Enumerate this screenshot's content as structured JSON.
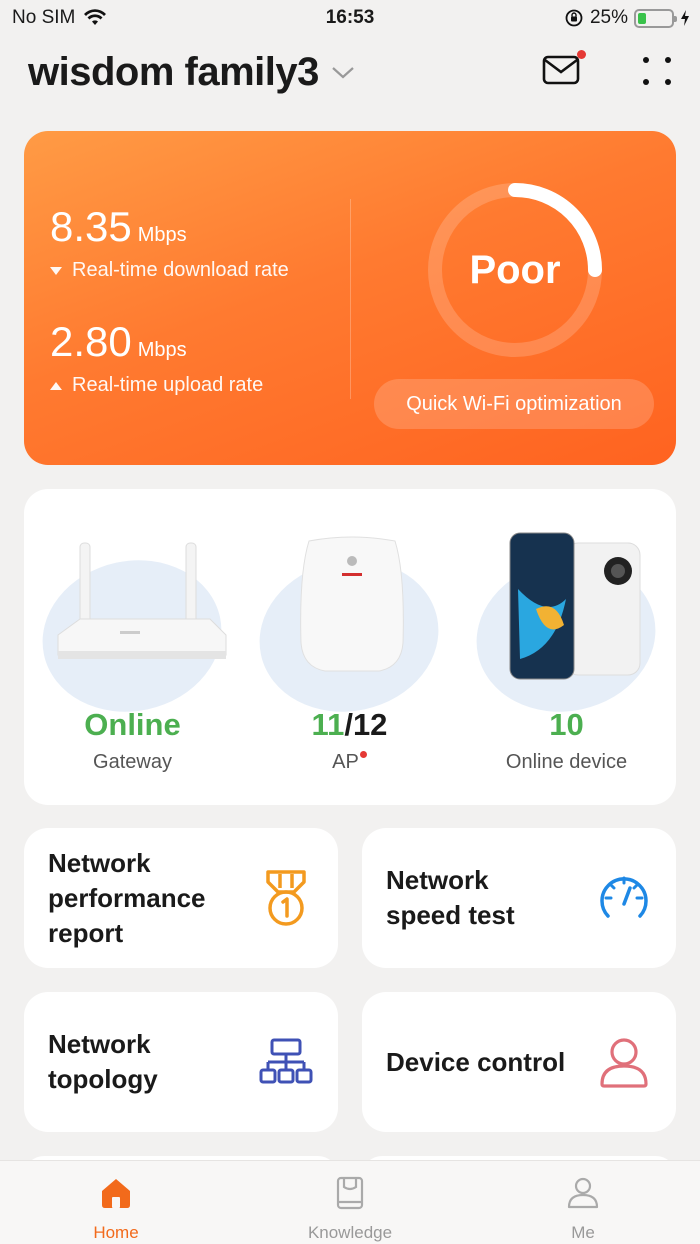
{
  "status_bar": {
    "carrier": "No SIM",
    "time": "16:53",
    "battery": "25%",
    "battery_level": 0.25
  },
  "header": {
    "title": "wisdom family3",
    "icons": [
      "chevron-down-icon",
      "mail-icon",
      "more-icon"
    ]
  },
  "speed": {
    "download_value": "8.35",
    "download_unit": "Mbps",
    "download_label": "Real-time download rate",
    "upload_value": "2.80",
    "upload_unit": "Mbps",
    "upload_label": "Real-time upload rate",
    "quality": "Poor",
    "quality_level": 0.25,
    "optimize_label": "Quick Wi-Fi optimization"
  },
  "devices": {
    "gateway_status": "Online",
    "gateway_label": "Gateway",
    "ap_online": "11",
    "ap_total": "/12",
    "ap_label": "AP",
    "device_count": "10",
    "device_label": "Online device"
  },
  "tiles": [
    {
      "line1": "Network",
      "line2": "performance",
      "line3": "report",
      "icon": "medal-icon"
    },
    {
      "line1": "Network",
      "line2": "speed test",
      "icon": "speedometer-icon"
    },
    {
      "line1": "Network",
      "line2": "topology",
      "icon": "topology-icon"
    },
    {
      "line1": "Device control",
      "icon": "user-icon"
    }
  ],
  "nav": [
    {
      "label": "Home",
      "icon": "home-icon",
      "active": true
    },
    {
      "label": "Knowledge",
      "icon": "book-icon",
      "active": false
    },
    {
      "label": "Me",
      "icon": "person-icon",
      "active": false
    }
  ],
  "colors": {
    "accent": "#f26a1b",
    "online": "#4caf50",
    "card_orange": "#ff7a30"
  }
}
